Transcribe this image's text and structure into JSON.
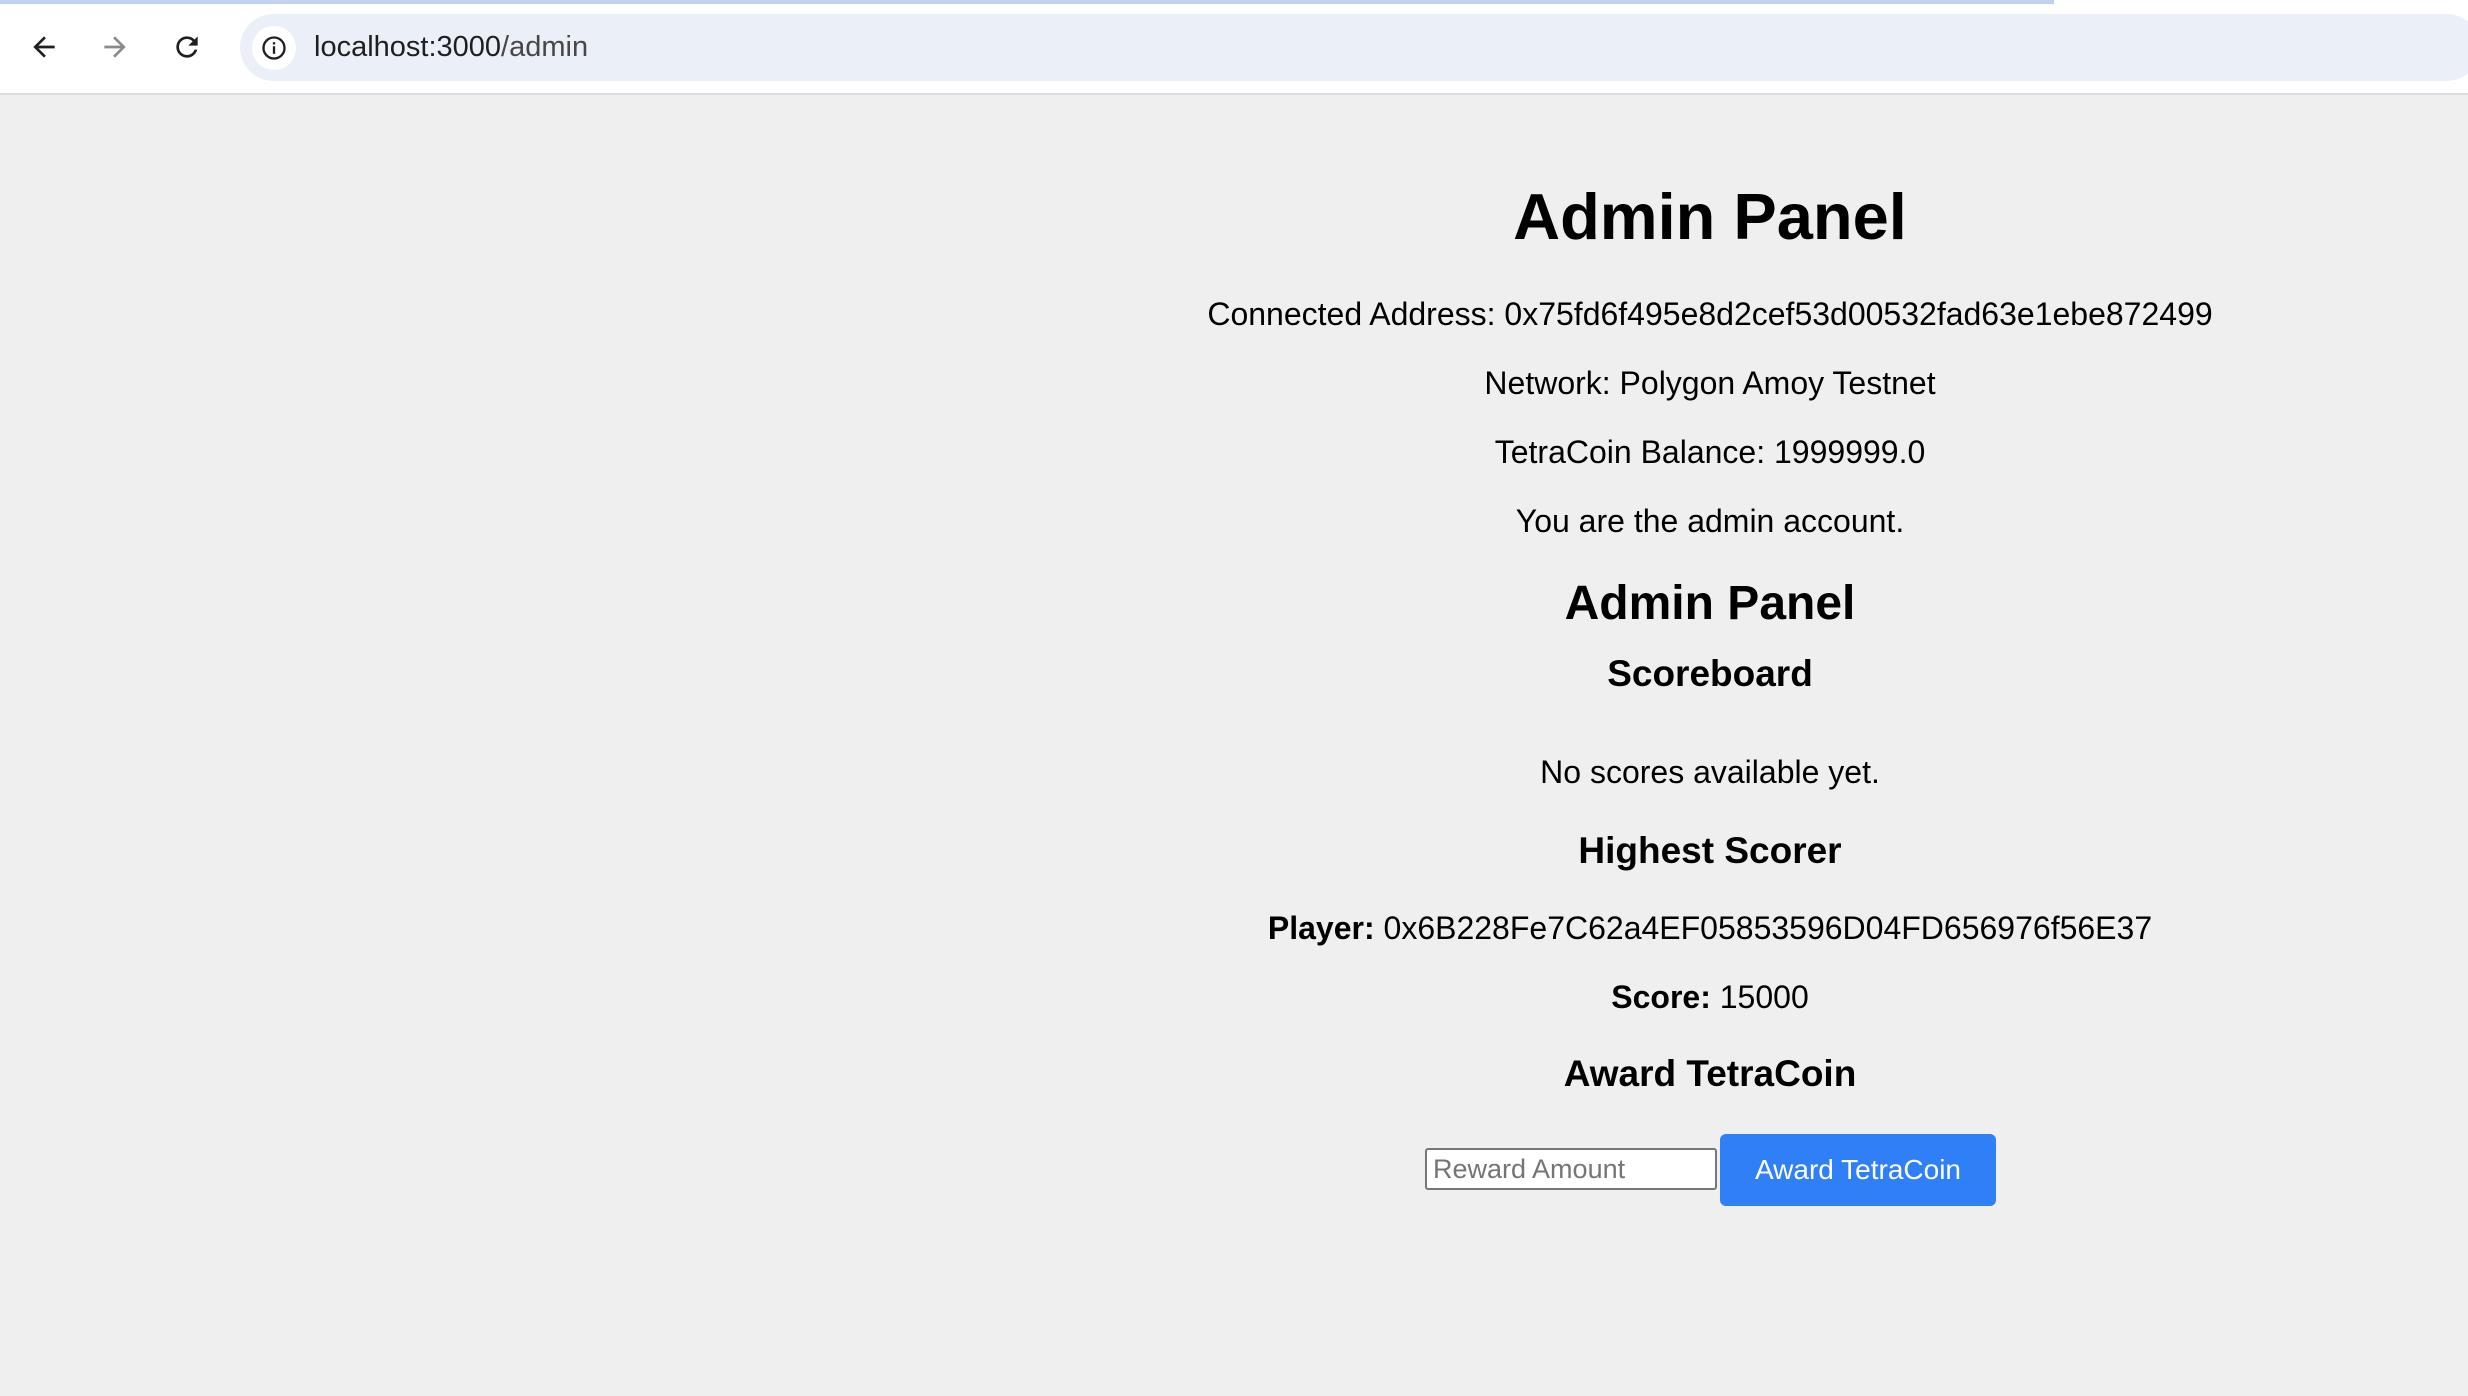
{
  "browser": {
    "url_host": "localhost:3000",
    "url_path": "/admin"
  },
  "page": {
    "title": "Admin Panel",
    "connected_address": "Connected Address: 0x75fd6f495e8d2cef53d00532fad63e1ebe872499",
    "network": "Network: Polygon Amoy Testnet",
    "balance": "TetraCoin Balance: 1999999.0",
    "admin_note": "You are the admin account.",
    "subtitle": "Admin Panel",
    "scoreboard": {
      "heading": "Scoreboard",
      "empty_text": "No scores available yet."
    },
    "highest_scorer": {
      "heading": "Highest Scorer",
      "player_label": "Player:",
      "player_value": "0x6B228Fe7C62a4EF05853596D04FD656976f56E37",
      "score_label": "Score:",
      "score_value": "15000"
    },
    "award": {
      "heading": "Award TetraCoin",
      "input_placeholder": "Reward Amount",
      "input_value": "",
      "button_label": "Award TetraCoin"
    }
  },
  "colors": {
    "page_background": "#efefef",
    "button_background": "#2f7ff7",
    "omnibox_background": "#ebeff8"
  }
}
